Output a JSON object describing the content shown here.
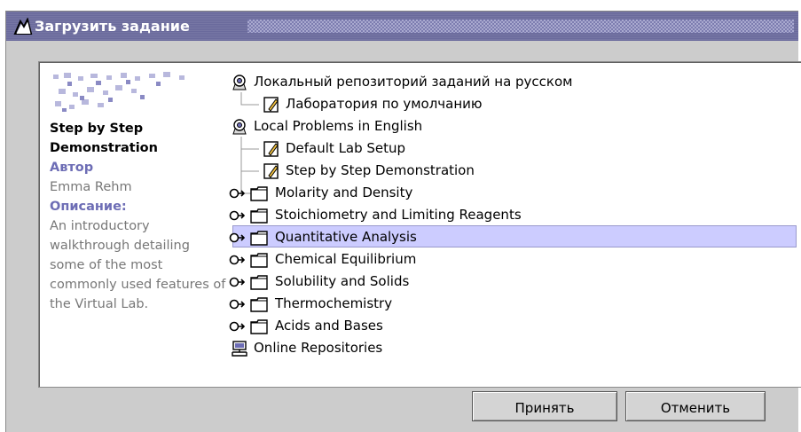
{
  "window": {
    "title": "Загрузить задание"
  },
  "details": {
    "lab_name": "Step by Step Demonstration",
    "author_heading": "Автор",
    "author": "Emma Rehm",
    "description_heading": "Описание:",
    "description": "An introductory walkthrough detailing some of the most commonly used features of the Virtual Lab."
  },
  "tree": {
    "items": [
      {
        "label": "Локальный репозиторий заданий на русском",
        "kind": "repository"
      },
      {
        "label": "Лаборатория по умолчанию",
        "kind": "lab"
      },
      {
        "label": "Local Problems in English",
        "kind": "repository"
      },
      {
        "label": "Default Lab Setup",
        "kind": "lab"
      },
      {
        "label": "Step by Step Demonstration",
        "kind": "lab",
        "selected": true
      },
      {
        "label": "Molarity and Density",
        "kind": "folder"
      },
      {
        "label": "Stoichiometry and Limiting Reagents",
        "kind": "folder"
      },
      {
        "label": "Quantitative Analysis",
        "kind": "folder"
      },
      {
        "label": "Chemical Equilibrium",
        "kind": "folder"
      },
      {
        "label": "Solubility and Solids",
        "kind": "folder"
      },
      {
        "label": "Thermochemistry",
        "kind": "folder"
      },
      {
        "label": "Acids and Bases",
        "kind": "folder"
      },
      {
        "label": "Online Repositories",
        "kind": "network"
      }
    ]
  },
  "buttons": {
    "accept": "Принять",
    "cancel": "Отменить"
  },
  "colors": {
    "titlebar": "#6a6a9c",
    "selection": "#ccccff",
    "heading": "#6d6db5"
  }
}
